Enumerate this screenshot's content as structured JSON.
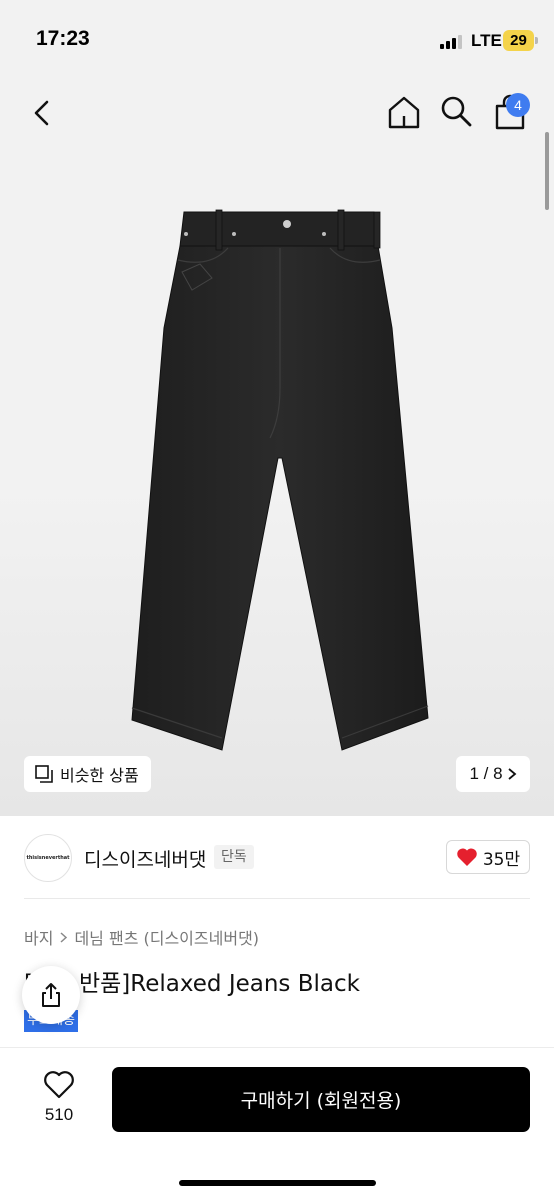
{
  "status_bar": {
    "time": "17:23",
    "network": "LTE",
    "battery": "29"
  },
  "header": {
    "back_icon": "chevron-left-icon",
    "home_icon": "home-icon",
    "search_icon": "search-icon",
    "bag_icon": "shopping-bag-icon",
    "bag_count": "4",
    "badge_color": "#3f7cf0"
  },
  "gallery": {
    "similar_label": "비슷한 상품",
    "page_indicator": "1 / 8"
  },
  "brand": {
    "name": "디스이즈네버댓",
    "tag": "단독",
    "logo_text": "thisisneverthat",
    "likes": "35만",
    "like_color": "#e5202e"
  },
  "breadcrumb": {
    "items": [
      "바지",
      "데님 팬츠 (디스이즈네버댓)"
    ]
  },
  "product": {
    "title_prefix": "[",
    "title_visible": "반품]Relaxed Jeans Black",
    "badge": "무료배송",
    "badge_color": "#2f6fe8"
  },
  "bottom_bar": {
    "wish_count": "510",
    "buy_label": "구매하기 (회원전용)"
  }
}
